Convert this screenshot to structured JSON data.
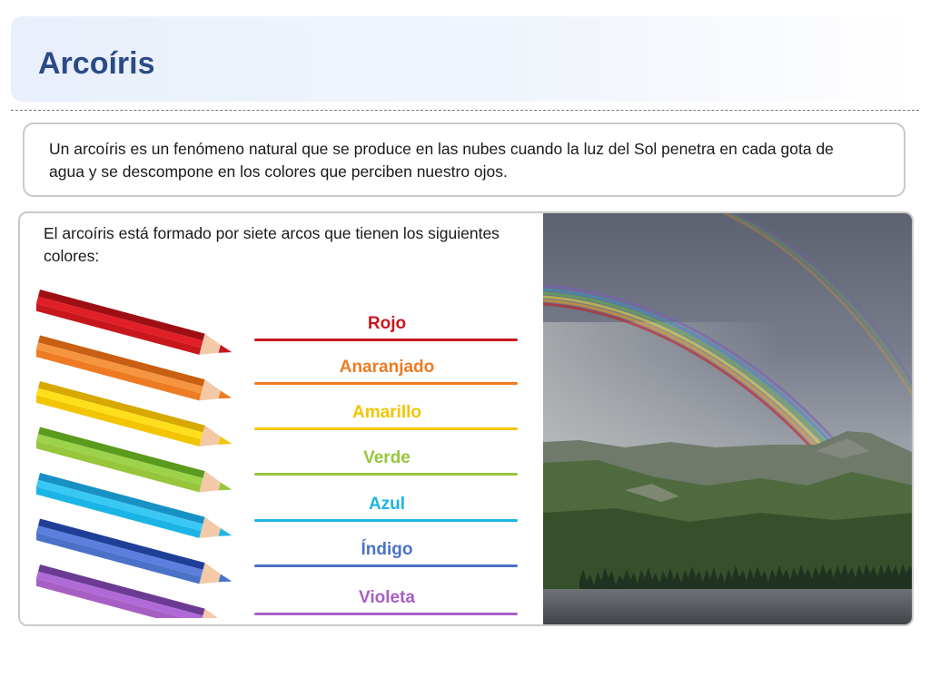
{
  "header": {
    "title": "Arcoíris"
  },
  "intro": {
    "text": "Un arcoíris es un fenómeno natural que se produce en las nubes cuando la luz del Sol penetra en cada gota de agua y se descompone en los colores que perciben nuestro ojos."
  },
  "panel": {
    "description": "El arcoíris está formado por siete arcos que tienen los siguientes colores:",
    "colors": [
      {
        "label": "Rojo",
        "color": "#c8161d",
        "light": "#e01f26",
        "dark": "#9e0f14"
      },
      {
        "label": "Anaranjado",
        "color": "#ee7b22",
        "light": "#f59540",
        "dark": "#c95f12"
      },
      {
        "label": "Amarillo",
        "color": "#f2c500",
        "light": "#ffdf1c",
        "dark": "#d7a800"
      },
      {
        "label": "Verde",
        "color": "#97c53c",
        "light": "#9dd24b",
        "dark": "#5a9a1d"
      },
      {
        "label": "Azul",
        "color": "#1bb4e6",
        "light": "#39c8f3",
        "dark": "#1791c4"
      },
      {
        "label": "Índigo",
        "color": "#4a72c9",
        "light": "#5c7fdd",
        "dark": "#1f3f97"
      },
      {
        "label": "Violeta",
        "color": "#a85fc4",
        "light": "#b06ad8",
        "dark": "#6b3b93"
      }
    ]
  }
}
